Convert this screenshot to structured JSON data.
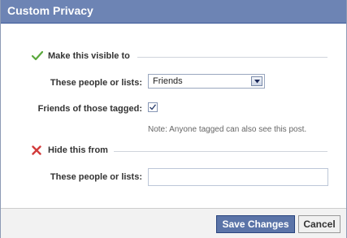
{
  "dialog": {
    "title": "Custom Privacy",
    "visible_section": {
      "heading": "Make this visible to",
      "icon": "green-check-icon",
      "people_label": "These people or lists:",
      "people_selected": "Friends",
      "tagged_label": "Friends of those tagged:",
      "tagged_checked": true,
      "note": "Note: Anyone tagged can also see this post."
    },
    "hide_section": {
      "heading": "Hide this from",
      "icon": "red-x-icon",
      "people_label": "These people or lists:",
      "people_value": ""
    },
    "buttons": {
      "save": "Save Changes",
      "cancel": "Cancel"
    }
  },
  "colors": {
    "titlebar": "#6d84b4",
    "primary_button": "#5b74a8",
    "check": "#5aa83c",
    "x": "#d23b3b"
  }
}
